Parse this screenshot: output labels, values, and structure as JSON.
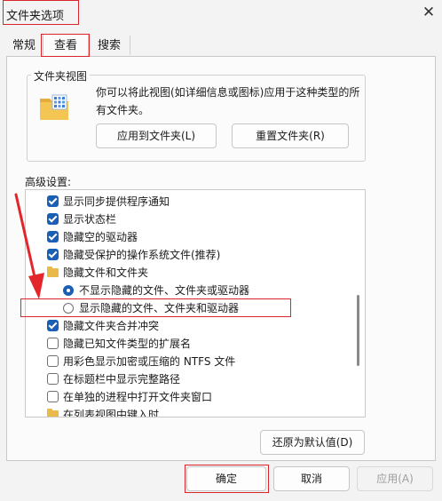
{
  "window": {
    "title": "文件夹选项",
    "close_glyph": "✕"
  },
  "tabs": [
    {
      "label": "常规"
    },
    {
      "label": "查看"
    },
    {
      "label": "搜索"
    }
  ],
  "folder_views": {
    "title": "文件夹视图",
    "description": "你可以将此视图(如详细信息或图标)应用于这种类型的所有文件夹。",
    "apply_button": "应用到文件夹(L)",
    "reset_button": "重置文件夹(R)",
    "icon": "folder-grid-icon"
  },
  "advanced": {
    "label": "高级设置:",
    "items": [
      {
        "type": "checkbox",
        "checked": true,
        "label": "显示同步提供程序通知"
      },
      {
        "type": "checkbox",
        "checked": true,
        "label": "显示状态栏"
      },
      {
        "type": "checkbox",
        "checked": true,
        "label": "隐藏空的驱动器"
      },
      {
        "type": "checkbox",
        "checked": true,
        "label": "隐藏受保护的操作系统文件(推荐)"
      },
      {
        "type": "folder",
        "label": "隐藏文件和文件夹"
      },
      {
        "type": "radio",
        "selected": true,
        "label": "不显示隐藏的文件、文件夹或驱动器"
      },
      {
        "type": "radio",
        "selected": false,
        "label": "显示隐藏的文件、文件夹和驱动器"
      },
      {
        "type": "checkbox",
        "checked": true,
        "label": "隐藏文件夹合并冲突"
      },
      {
        "type": "checkbox",
        "checked": false,
        "label": "隐藏已知文件类型的扩展名"
      },
      {
        "type": "checkbox",
        "checked": false,
        "label": "用彩色显示加密或压缩的 NTFS 文件"
      },
      {
        "type": "checkbox",
        "checked": false,
        "label": "在标题栏中显示完整路径"
      },
      {
        "type": "checkbox",
        "checked": false,
        "label": "在单独的进程中打开文件夹窗口"
      },
      {
        "type": "folder",
        "label": "在列表视图中键入时"
      }
    ]
  },
  "buttons": {
    "restore_defaults": "还原为默认值(D)",
    "ok": "确定",
    "cancel": "取消",
    "apply": "应用(A)"
  },
  "colors": {
    "accent": "#1a5fb4",
    "highlight": "#d9262c",
    "folder": "#e9b94a"
  }
}
